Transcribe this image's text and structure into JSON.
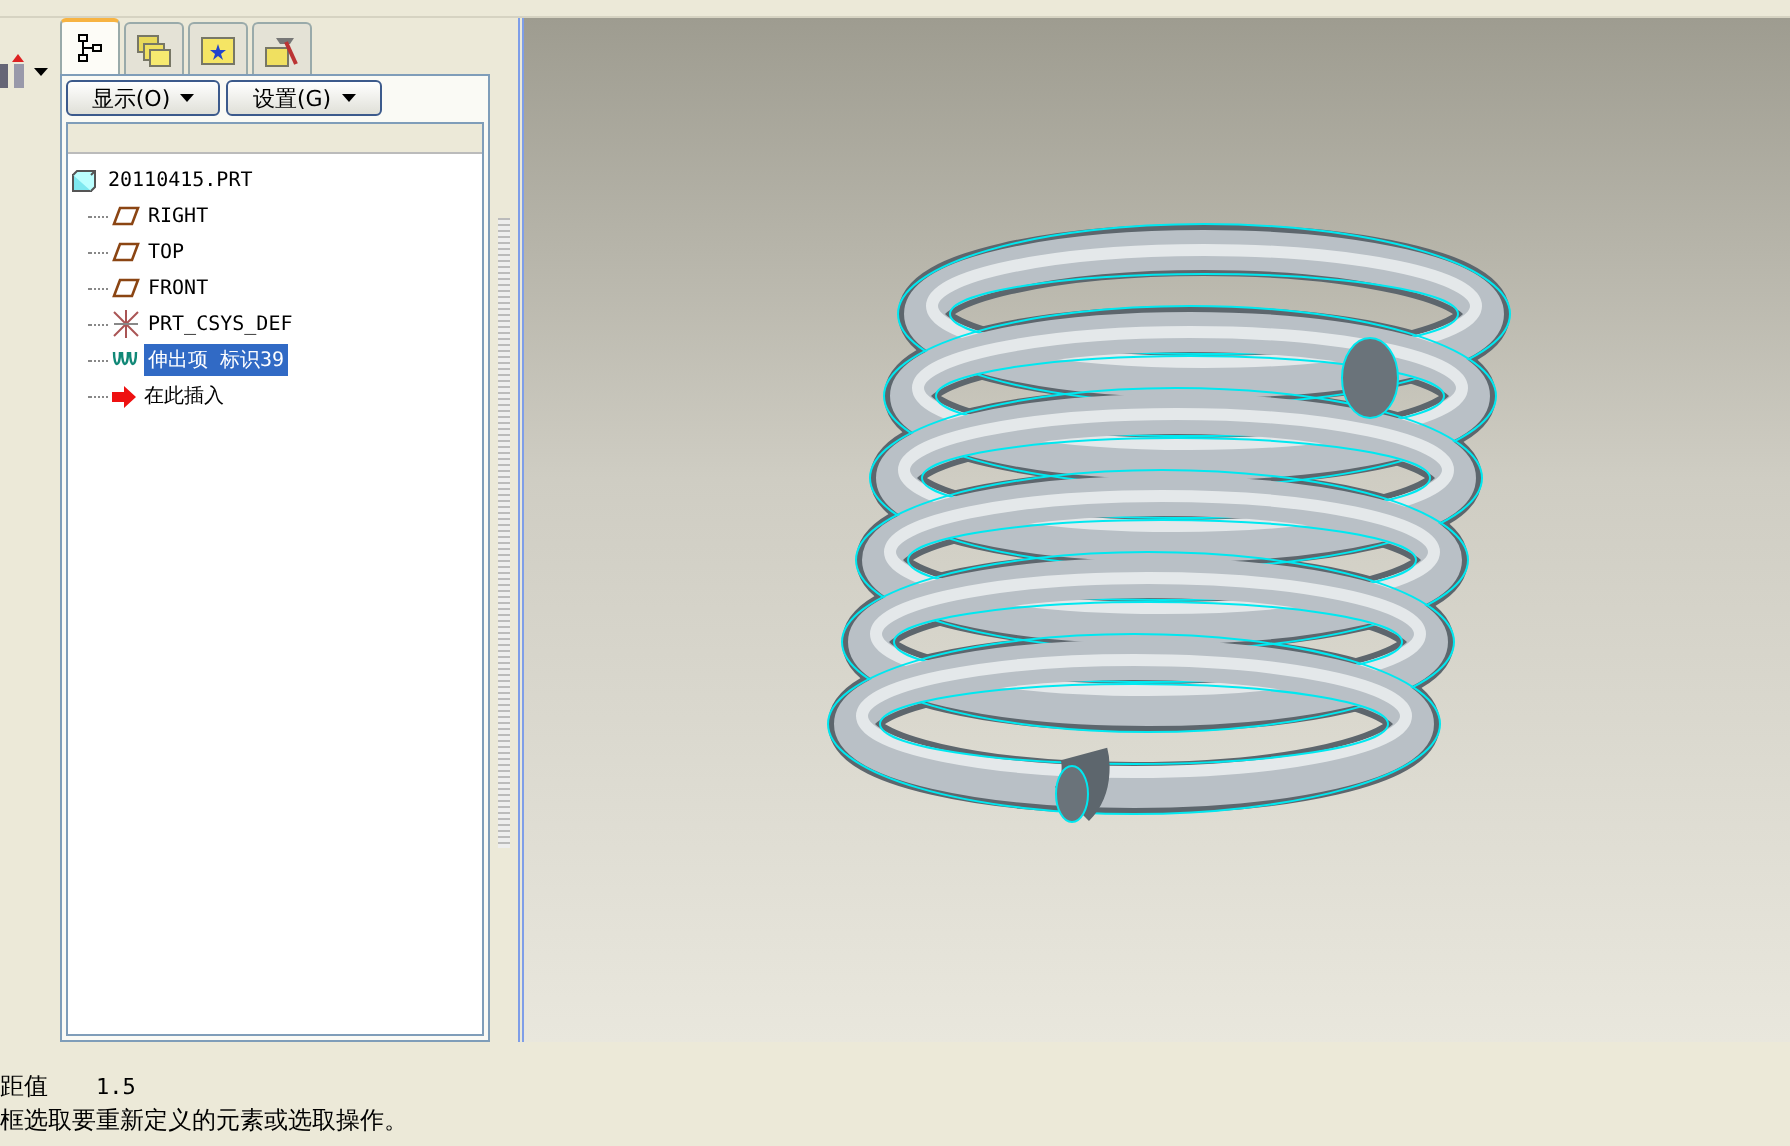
{
  "panel_tabs": [
    {
      "kind": "tree",
      "selected": true
    },
    {
      "kind": "folders",
      "selected": false
    },
    {
      "kind": "favorites",
      "selected": false
    },
    {
      "kind": "tools",
      "selected": false
    }
  ],
  "panel_menus": [
    "显示(O)",
    "设置(G)"
  ],
  "model_tree": {
    "label": "20110415.PRT",
    "children": [
      {
        "kind": "plane",
        "label": "RIGHT",
        "selected": false
      },
      {
        "kind": "plane",
        "label": "TOP",
        "selected": false
      },
      {
        "kind": "plane",
        "label": "FRONT",
        "selected": false
      },
      {
        "kind": "csys",
        "label": "PRT_CSYS_DEF",
        "selected": false
      },
      {
        "kind": "extrude",
        "label": "伸出项 标识39",
        "selected": true
      },
      {
        "kind": "insert",
        "label": "在此插入",
        "selected": false
      }
    ]
  },
  "message_area": [
    {
      "label": "距值",
      "value": "1.5"
    },
    {
      "label": "框选取要重新定义的元素或选取操作。"
    }
  ]
}
